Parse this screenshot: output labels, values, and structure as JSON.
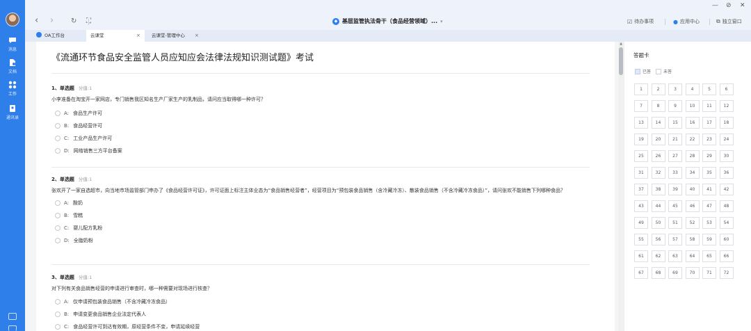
{
  "window": {
    "title": "基层监管执法骨干（食品经营领域）...",
    "controls": {
      "minimize": "—",
      "restore": "⊘",
      "close": "✕"
    }
  },
  "sidebar": {
    "items": [
      {
        "label": "消息",
        "icon": "chat-icon"
      },
      {
        "label": "文档",
        "icon": "document-icon"
      },
      {
        "label": "工作",
        "icon": "grid-icon",
        "active": true
      },
      {
        "label": "通讯录",
        "icon": "contacts-icon"
      }
    ]
  },
  "toolbar": {
    "back": "‹",
    "forward": "›",
    "refresh": "↻",
    "fullscreen": "⛶",
    "todo": "待办事项",
    "app_center": "应用中心",
    "standalone": "独立窗口"
  },
  "tabs": [
    {
      "label": "OA工作台"
    },
    {
      "label": "云课堂",
      "active": true,
      "close": "×"
    },
    {
      "label": "云课堂-管理中心",
      "close": "×"
    }
  ],
  "exam": {
    "title": "《流通环节食品安全监管人员应知应会法律法规知识测试题》考试",
    "questions": [
      {
        "header": "1、单选题",
        "score": "分值:1",
        "text": "小李准备在淘宝开一家网店，专门销售我区知名生产厂家生产的乳制品，请问应当取得哪一种许可？",
        "options": [
          {
            "key": "A:",
            "text": "食品生产许可"
          },
          {
            "key": "B:",
            "text": "食品经营许可"
          },
          {
            "key": "C:",
            "text": "工业产品生产许可"
          },
          {
            "key": "D:",
            "text": "网络销售三方平台备案"
          }
        ]
      },
      {
        "header": "2、单选题",
        "score": "分值:1",
        "text": "张欢开了一家自选超市，向当地市场监管部门申办了《食品经营许可证》，许可证面上标注主体业态为“食品销售经营者”，经营项目为“预包装食品销售（含冷藏冷冻）、散装食品销售（不含冷藏冷冻食品）”，请问张欢不能销售下列哪种食品？",
        "options": [
          {
            "key": "A:",
            "text": "酸奶"
          },
          {
            "key": "B:",
            "text": "雪糕"
          },
          {
            "key": "C:",
            "text": "婴儿配方乳粉"
          },
          {
            "key": "D:",
            "text": "全脂奶粉"
          }
        ]
      },
      {
        "header": "3、单选题",
        "score": "分值:1",
        "text": "对下列有关食品销售经营的申请进行审查时，哪一种需要对现场进行核查？",
        "options": [
          {
            "key": "A:",
            "text": "仅申请预包装食品销售（不含冷藏冷冻食品）"
          },
          {
            "key": "B:",
            "text": "申请变更食品销售企业法定代表人"
          },
          {
            "key": "C:",
            "text": "食品经营许可到达有效期，原经营条件不变，申请延续经营"
          }
        ]
      }
    ]
  },
  "answer_card": {
    "title": "答题卡",
    "legend_answered": "已答",
    "legend_unanswered": "未答",
    "numbers": [
      "1",
      "2",
      "3",
      "4",
      "5",
      "6",
      "7",
      "8",
      "9",
      "10",
      "11",
      "12",
      "13",
      "14",
      "15",
      "16",
      "17",
      "18",
      "19",
      "20",
      "21",
      "22",
      "23",
      "24",
      "25",
      "26",
      "27",
      "28",
      "29",
      "30",
      "31",
      "32",
      "33",
      "34",
      "35",
      "36",
      "37",
      "38",
      "39",
      "40",
      "41",
      "42",
      "43",
      "44",
      "45",
      "46",
      "47",
      "48",
      "49",
      "50",
      "51",
      "52",
      "53",
      "54",
      "55",
      "56",
      "57",
      "58",
      "59",
      "60",
      "61",
      "62",
      "63",
      "64",
      "65",
      "66",
      "67",
      "68",
      "69",
      "70",
      "71",
      "72"
    ]
  },
  "colors": {
    "accent": "#2f7fea",
    "sidebar": "#2f7fea"
  }
}
